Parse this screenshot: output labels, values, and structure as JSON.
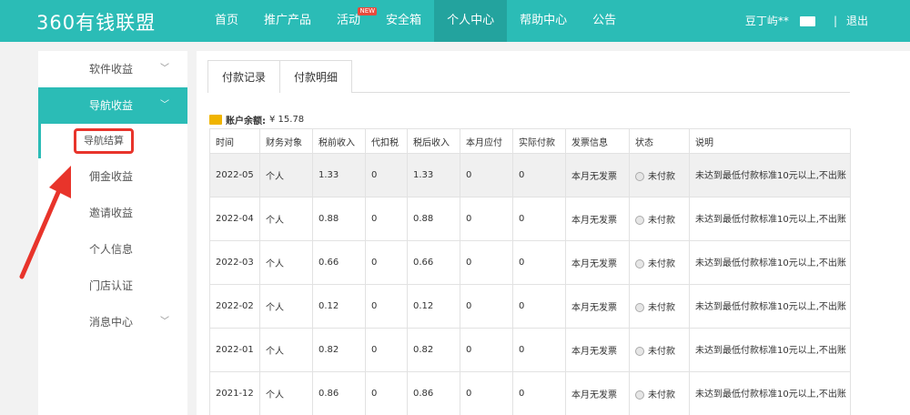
{
  "header": {
    "logo": "360有钱联盟",
    "nav": [
      {
        "label": "首页",
        "active": false
      },
      {
        "label": "推广产品",
        "active": false
      },
      {
        "label": "活动",
        "active": false,
        "badge": "NEW"
      },
      {
        "label": "安全箱",
        "active": false
      },
      {
        "label": "个人中心",
        "active": true
      },
      {
        "label": "帮助中心",
        "active": false
      },
      {
        "label": "公告",
        "active": false
      }
    ],
    "username": "豆丁屿**",
    "logout": "退出",
    "separator": "|"
  },
  "sidebar": {
    "items": [
      {
        "label": "软件收益",
        "chevron": "﹀"
      },
      {
        "label": "导航收益",
        "chevron": "﹀",
        "active": true
      },
      {
        "label": "导航结算",
        "sub": true
      },
      {
        "label": "佣金收益"
      },
      {
        "label": "邀请收益"
      },
      {
        "label": "个人信息"
      },
      {
        "label": "门店认证"
      },
      {
        "label": "消息中心",
        "chevron": "﹀"
      }
    ]
  },
  "tabs": [
    "付款记录",
    "付款明细"
  ],
  "balance": {
    "label": "账户余额:",
    "value": "¥ 15.78"
  },
  "table": {
    "headers": [
      "时间",
      "财务对象",
      "税前收入",
      "代扣税",
      "税后收入",
      "本月应付",
      "实际付款",
      "发票信息",
      "状态",
      "说明"
    ],
    "rows": [
      [
        "2022-05",
        "个人",
        "1.33",
        "0",
        "1.33",
        "0",
        "0",
        "本月无发票",
        "未付款",
        "未达到最低付款标准10元以上,不出账"
      ],
      [
        "2022-04",
        "个人",
        "0.88",
        "0",
        "0.88",
        "0",
        "0",
        "本月无发票",
        "未付款",
        "未达到最低付款标准10元以上,不出账"
      ],
      [
        "2022-03",
        "个人",
        "0.66",
        "0",
        "0.66",
        "0",
        "0",
        "本月无发票",
        "未付款",
        "未达到最低付款标准10元以上,不出账"
      ],
      [
        "2022-02",
        "个人",
        "0.12",
        "0",
        "0.12",
        "0",
        "0",
        "本月无发票",
        "未付款",
        "未达到最低付款标准10元以上,不出账"
      ],
      [
        "2022-01",
        "个人",
        "0.82",
        "0",
        "0.82",
        "0",
        "0",
        "本月无发票",
        "未付款",
        "未达到最低付款标准10元以上,不出账"
      ],
      [
        "2021-12",
        "个人",
        "0.86",
        "0",
        "0.86",
        "0",
        "0",
        "本月无发票",
        "未付款",
        "未达到最低付款标准10元以上,不出账"
      ]
    ]
  },
  "colors": {
    "accent": "#2bbcb6",
    "highlight": "#e8342b"
  }
}
